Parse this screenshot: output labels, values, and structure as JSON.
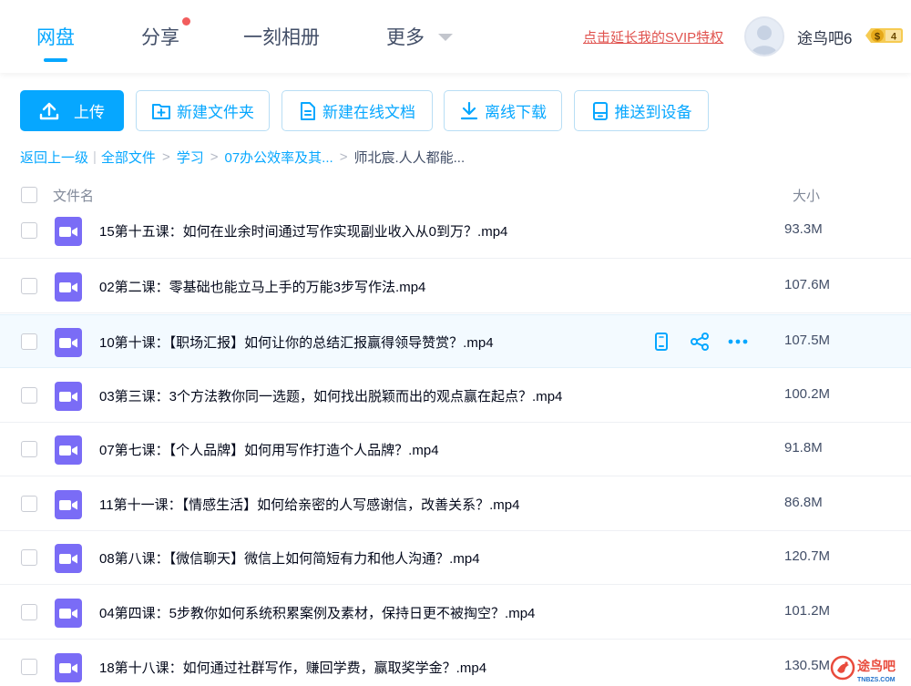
{
  "nav": {
    "items": [
      {
        "label": "网盘",
        "active": true
      },
      {
        "label": "分享",
        "active": false
      },
      {
        "label": "一刻相册",
        "active": false
      },
      {
        "label": "更多",
        "active": false
      }
    ],
    "svip_link": "点击延长我的SVIP特权",
    "username": "途鸟吧6",
    "badge_symbol": "$",
    "badge_level": "4"
  },
  "toolbar": {
    "upload": "上传",
    "new_folder": "新建文件夹",
    "new_doc": "新建在线文档",
    "offline_download": "离线下载",
    "push_device": "推送到设备"
  },
  "breadcrumb": {
    "back": "返回上一级",
    "all_files": "全部文件",
    "level1": "学习",
    "level2": "07办公效率及其...",
    "current": "师北宸.人人都能..."
  },
  "list": {
    "col_name": "文件名",
    "col_size": "大小",
    "rows": [
      {
        "name": "15第十五课：如何在业余时间通过写作实现副业收入从0到万？.mp4",
        "size": "93.3M"
      },
      {
        "name": "02第二课：零基础也能立马上手的万能3步写作法.mp4",
        "size": "107.6M"
      },
      {
        "name": "10第十课：【职场汇报】如何让你的总结汇报赢得领导赞赏？.mp4",
        "size": "107.5M"
      },
      {
        "name": "03第三课：3个方法教你同一选题，如何找出脱颖而出的观点赢在起点？.mp4",
        "size": "100.2M"
      },
      {
        "name": "07第七课：【个人品牌】如何用写作打造个人品牌？.mp4",
        "size": "91.8M"
      },
      {
        "name": "11第十一课：【情感生活】如何给亲密的人写感谢信，改善关系？.mp4",
        "size": "86.8M"
      },
      {
        "name": "08第八课：【微信聊天】微信上如何简短有力和他人沟通？.mp4",
        "size": "120.7M"
      },
      {
        "name": "04第四课：5步教你如何系统积累案例及素材，保持日更不被掏空？.mp4",
        "size": "101.2M"
      },
      {
        "name": "18第十八课：如何通过社群写作，赚回学费，赢取奖学金？.mp4",
        "size": "130.5M"
      }
    ]
  },
  "watermark": {
    "brand": "途鸟吧",
    "site": "TNBZS.COM"
  },
  "colors": {
    "accent": "#06a7ff",
    "video_icon": "#7a6cf6",
    "link_red": "#e0534f"
  }
}
